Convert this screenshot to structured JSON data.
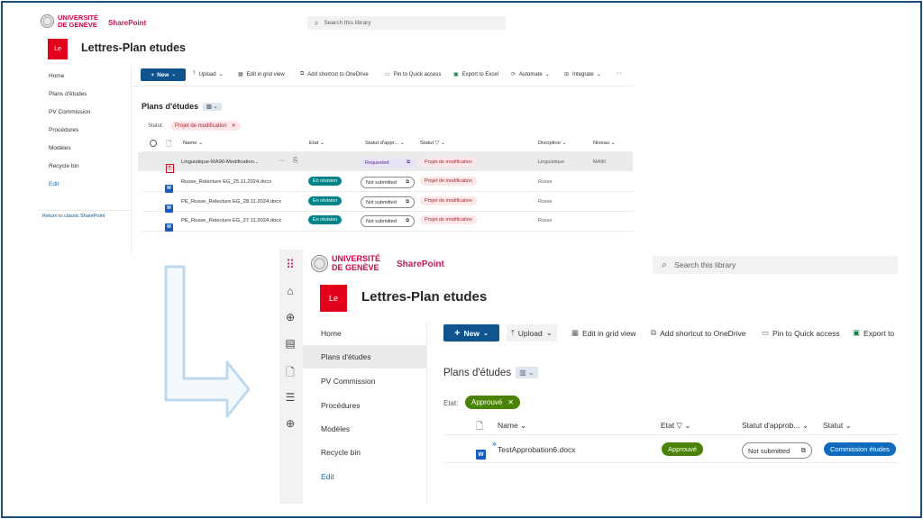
{
  "brand": {
    "university_line1": "UNIVERSITÉ",
    "university_line2": "DE GENÈVE",
    "app": "SharePoint"
  },
  "top": {
    "search_placeholder": "Search this library",
    "site_logo": "Le",
    "site_title": "Lettres-Plan etudes",
    "nav": [
      "Home",
      "Plans d'études",
      "PV Commission",
      "Procédures",
      "Modèles",
      "Recycle bin",
      "Edit"
    ],
    "return_link": "Return to classic SharePoint",
    "toolbar": {
      "new": "New",
      "items": [
        "Upload",
        "Edit in grid view",
        "Add shortcut to OneDrive",
        "Pin to Quick access",
        "Export to Excel",
        "Automate",
        "Integrate"
      ],
      "more": "···"
    },
    "library_title": "Plans d'études",
    "filter_label": "Statut:",
    "filter_value": "Projet de modification",
    "columns": {
      "name": "Name",
      "etat": "Etat",
      "approval": "Statut d'appr...",
      "statut": "Statut",
      "discipline": "Discipline",
      "niveau": "Niveau"
    },
    "rows": [
      {
        "name": "Linguistique-MA90-Modification...",
        "etat": "",
        "approval": "Requested",
        "statut": "Projet de modification",
        "discipline": "Linguistique",
        "niveau": "MA90",
        "type": "pdf"
      },
      {
        "name": "Russe_Relecture EG_25.11.2024.docx",
        "etat": "En révision",
        "approval": "Not submitted",
        "statut": "Projet de modification",
        "discipline": "Russe",
        "niveau": "",
        "type": "docx"
      },
      {
        "name": "PE_Russe_Relecture EG_28.11.2024.docx",
        "etat": "En révision",
        "approval": "Not submitted",
        "statut": "Projet de modification",
        "discipline": "Russe",
        "niveau": "",
        "type": "docx"
      },
      {
        "name": "PE_Russe_Relecture EG_27.11.2024.docx",
        "etat": "En révision",
        "approval": "Not submitted",
        "statut": "Projet de modification",
        "discipline": "Russe",
        "niveau": "",
        "type": "docx"
      }
    ]
  },
  "bottom": {
    "search_placeholder": "Search this library",
    "site_logo": "Le",
    "site_title": "Lettres-Plan etudes",
    "nav": [
      "Home",
      "Plans d'études",
      "PV Commission",
      "Procédures",
      "Modèles",
      "Recycle bin",
      "Edit"
    ],
    "toolbar": {
      "new": "New",
      "items": [
        "Upload",
        "Edit in grid view",
        "Add shortcut to OneDrive",
        "Pin to Quick access",
        "Export to"
      ]
    },
    "library_title": "Plans d'études",
    "filter_label": "Etat:",
    "filter_value": "Approuvé",
    "columns": {
      "name": "Name",
      "etat": "Etat",
      "approval": "Statut d'approb...",
      "statut": "Statut"
    },
    "rows": [
      {
        "name": "TestApprobation6.docx",
        "etat": "Approuvé",
        "approval": "Not submitted",
        "statut": "Commission études"
      }
    ]
  },
  "colors": {
    "frame": "#1e4e79",
    "accent": "#0f548c",
    "unige_red": "#d1004b",
    "arrow": "#bcd9f0"
  }
}
